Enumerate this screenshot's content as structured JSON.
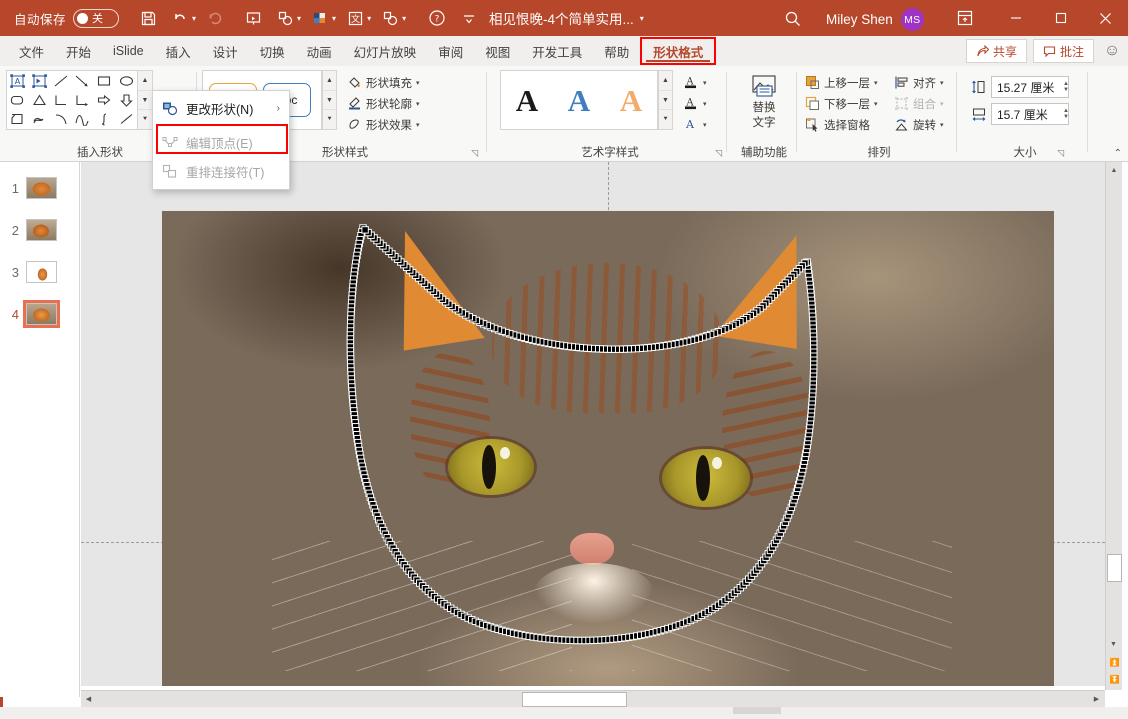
{
  "titlebar": {
    "autosave_label": "自动保存",
    "autosave_state": "关",
    "doc_title": "相见恨晚-4个简单实用...",
    "account_name": "Miley Shen",
    "avatar_initials": "MS",
    "background_color": "#b7472a",
    "icons": [
      "save-icon",
      "undo-icon",
      "redo-icon",
      "start-slideshow-icon",
      "shape-icon",
      "color-palette-icon",
      "translate-icon",
      "shape2-icon",
      "help-icon",
      "more-commands-icon",
      "search-icon",
      "ribbon-display-icon"
    ],
    "window_buttons": [
      "minimize",
      "maximize",
      "close"
    ]
  },
  "tabs": [
    {
      "label": "文件",
      "active": false
    },
    {
      "label": "开始",
      "active": false
    },
    {
      "label": "iSlide",
      "active": false
    },
    {
      "label": "插入",
      "active": false
    },
    {
      "label": "设计",
      "active": false
    },
    {
      "label": "切换",
      "active": false
    },
    {
      "label": "动画",
      "active": false
    },
    {
      "label": "幻灯片放映",
      "active": false
    },
    {
      "label": "审阅",
      "active": false
    },
    {
      "label": "视图",
      "active": false
    },
    {
      "label": "开发工具",
      "active": false
    },
    {
      "label": "帮助",
      "active": false
    },
    {
      "label": "形状格式",
      "active": true
    }
  ],
  "tabbar_right": {
    "share_label": "共享",
    "comment_label": "批注",
    "smiley_icon": "feedback-smiley-icon",
    "accent_color": "#b7472a"
  },
  "ribbon": {
    "groups": [
      {
        "name": "insert-shapes",
        "label": "插入形状"
      },
      {
        "name": "shape-styles",
        "label": "形状样式"
      },
      {
        "name": "wordart-styles",
        "label": "艺术字样式"
      },
      {
        "name": "accessibility",
        "label": "辅助功能"
      },
      {
        "name": "arrange",
        "label": "排列"
      },
      {
        "name": "size",
        "label": "大小"
      }
    ],
    "shape_styles": {
      "fill_label": "形状填充",
      "outline_label": "形状轮廓",
      "effects_label": "形状效果",
      "chip_text": "Abc"
    },
    "wordart": {
      "text_fill_label": "text-fill-icon",
      "text_outline_label": "text-outline-icon",
      "text_effects_label": "text-effects-icon",
      "samples": [
        "A",
        "A",
        "A"
      ]
    },
    "accessibility": {
      "alt_text_line1": "替换",
      "alt_text_line2": "文字"
    },
    "arrange": {
      "bring_forward": "上移一层",
      "send_backward": "下移一层",
      "selection_pane": "选择窗格",
      "align": "对齐",
      "group": "组合",
      "rotate": "旋转"
    },
    "size": {
      "height_value": "15.27 厘米",
      "width_value": "15.7 厘米",
      "height_icon": "shape-height-icon",
      "width_icon": "shape-width-icon"
    }
  },
  "menu": {
    "items": [
      {
        "label": "更改形状(N)",
        "icon": "change-shape-icon",
        "disabled": false,
        "submenu": "›"
      },
      {
        "label": "编辑顶点(E)",
        "icon": "edit-points-icon",
        "disabled": true,
        "submenu": ""
      },
      {
        "label": "重排连接符(T)",
        "icon": "reroute-connectors-icon",
        "disabled": true,
        "submenu": ""
      }
    ],
    "highlight_color": "#ff0000"
  },
  "slide_panel": {
    "slides": [
      {
        "number": "1",
        "selected": false
      },
      {
        "number": "2",
        "selected": false
      },
      {
        "number": "3",
        "selected": false
      },
      {
        "number": "4",
        "selected": true
      }
    ],
    "selection_color": "#e8704f"
  },
  "canvas": {
    "shape_name": "cat-head-vertex-path",
    "vertex_handle_color": "#000000",
    "path_line_color": "#cc2222",
    "guides": [
      "vertical-guide",
      "horizontal-guide"
    ]
  },
  "scrollbars": {
    "horizontal": {
      "left_arrow": "◀",
      "right_arrow": "▶"
    },
    "vertical": {
      "up_arrow": "▲",
      "down_arrow": "▼",
      "prev_slide": "⏫",
      "next_slide": "⏬"
    }
  }
}
